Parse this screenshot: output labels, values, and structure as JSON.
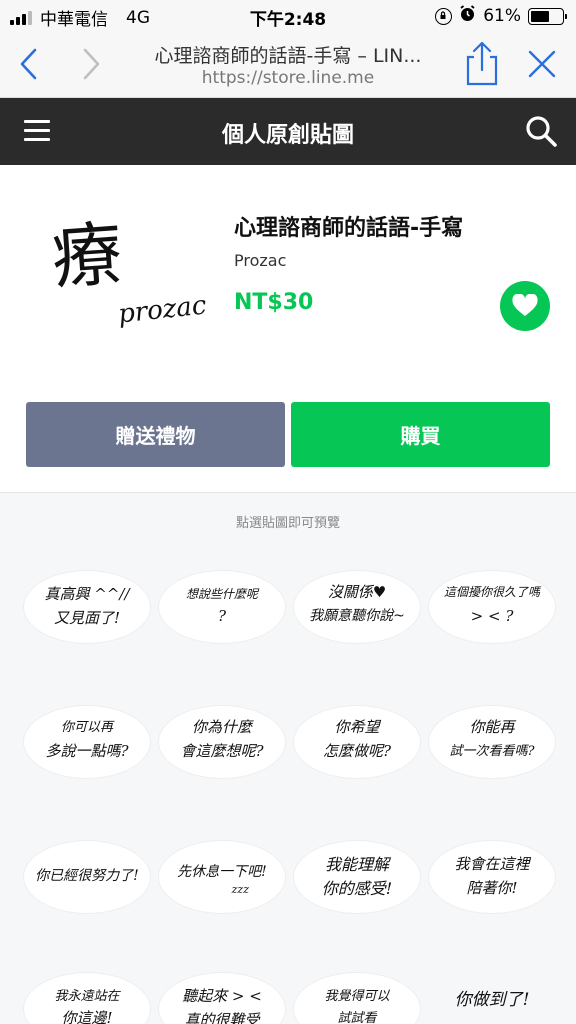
{
  "status_bar": {
    "carrier": "中華電信",
    "network": "4G",
    "time": "下午2:48",
    "battery": "61%",
    "battery_level": 0.61
  },
  "browser": {
    "page_title": "心理諮商師的話語-手寫 – LIN...",
    "url": "https://store.line.me"
  },
  "app_header": {
    "title": "個人原創貼圖"
  },
  "product": {
    "thumbnail_text": "療",
    "thumbnail_signature": "prozac",
    "name": "心理諮商師的話語-手寫",
    "author": "Prozac",
    "price": "NT$30",
    "accent_color": "#06c755"
  },
  "actions": {
    "gift_label": "贈送禮物",
    "buy_label": "購買"
  },
  "stickers": {
    "hint": "點選貼圖即可預覽",
    "items": [
      {
        "line1": "真高興 ^^//",
        "line2": "又見面了!"
      },
      {
        "line1": "想說些什麼呢",
        "line2": "?"
      },
      {
        "line1": "沒關係♥",
        "line2": "我願意聽你說~"
      },
      {
        "line1": "這個擾你很久了嗎",
        "line2": "> <   ?"
      },
      {
        "line1": "你可以再",
        "line2": "多說一點嗎?"
      },
      {
        "line1": "你為什麼",
        "line2": "會這麼想呢?"
      },
      {
        "line1": "你希望",
        "line2": "怎麼做呢?"
      },
      {
        "line1": "你能再",
        "line2": "試一次看看嗎?"
      },
      {
        "line1": "你已經很努力了!",
        "line2": ""
      },
      {
        "line1": "先休息一下吧!",
        "line2": "zzz"
      },
      {
        "line1": "我能理解",
        "line2": "你的感受!"
      },
      {
        "line1": "我會在這裡",
        "line2": "陪著你!"
      },
      {
        "line1": "我永遠站在",
        "line2": "你這邊!"
      },
      {
        "line1": "聽起來 > <",
        "line2": "真的很難受"
      },
      {
        "line1": "我覺得可以",
        "line2": "試試看"
      },
      {
        "line1": "你做到了!",
        "line2": ""
      }
    ]
  }
}
